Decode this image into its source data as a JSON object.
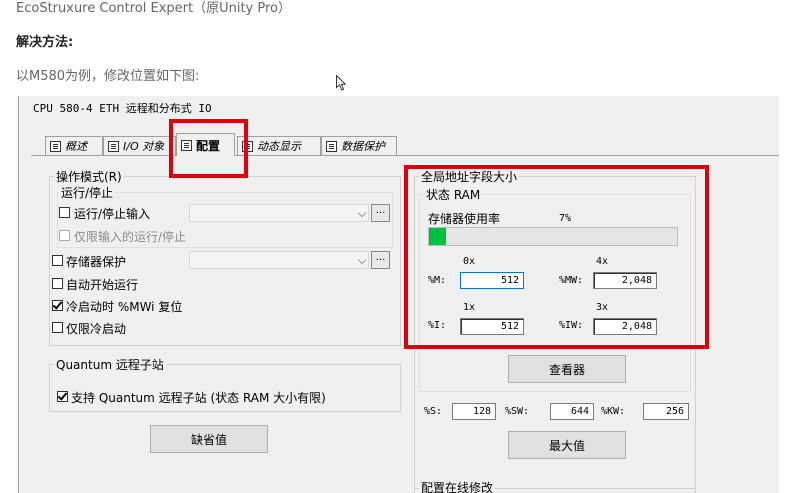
{
  "doc": {
    "product_line": "EcoStruxure Control Expert（原Unity Pro）",
    "solution_heading": "解决方法:",
    "example_text": "以M580为例，修改位置如下图:"
  },
  "window": {
    "title": "CPU 580-4 ETH 远程和分布式 IO",
    "tabs": [
      {
        "label": "概述",
        "active": false
      },
      {
        "label": "I/O 对象",
        "active": false
      },
      {
        "label": "配置",
        "active": true
      },
      {
        "label": "动态显示",
        "active": false
      },
      {
        "label": "数据保护",
        "active": false
      }
    ]
  },
  "operating_mode": {
    "label": "操作模式(R)",
    "run_stop_label": "运行/停止",
    "run_stop_input": {
      "label": "运行/停止输入",
      "checked": false
    },
    "run_stop_input_only": {
      "label": "仅限输入的运行/停止",
      "checked": false,
      "disabled": true
    },
    "memory_protect": {
      "label": "存储器保护",
      "checked": false
    },
    "auto_start": {
      "label": "自动开始运行",
      "checked": false
    },
    "cold_start_reset": {
      "label": "冷启动时 %MWi 复位",
      "checked": true
    },
    "cold_start_only": {
      "label": "仅限冷启动",
      "checked": false
    },
    "dots_label": "..."
  },
  "quantum": {
    "group_label": "Quantum 远程子站",
    "support": {
      "label": "支持 Quantum 远程子站 (状态 RAM 大小有限)",
      "checked": true
    }
  },
  "default_button": "缺省值",
  "global_address": {
    "group_label": "全局地址字段大小",
    "state_ram_label": "状态 RAM",
    "memory_usage_label": "存储器使用率",
    "memory_usage_percent": "7%",
    "memory_usage_fraction": 0.07,
    "col_0x": "0x",
    "col_4x": "4x",
    "col_1x": "1x",
    "col_3x": "3x",
    "m_label": "%M:",
    "m_value": "512",
    "mw_label": "%MW:",
    "mw_value": "2,048",
    "i_label": "%I:",
    "i_value": "512",
    "iw_label": "%IW:",
    "iw_value": "2,048",
    "viewer_button": "查看器",
    "s_label": "%S:",
    "s_value": "128",
    "sw_label": "%SW:",
    "sw_value": "644",
    "kw_label": "%KW:",
    "kw_value": "256",
    "max_button": "最大值"
  },
  "online_modify_label": "配置在线修改",
  "colors": {
    "highlight": "#e0000d",
    "progress": "#00c040"
  }
}
